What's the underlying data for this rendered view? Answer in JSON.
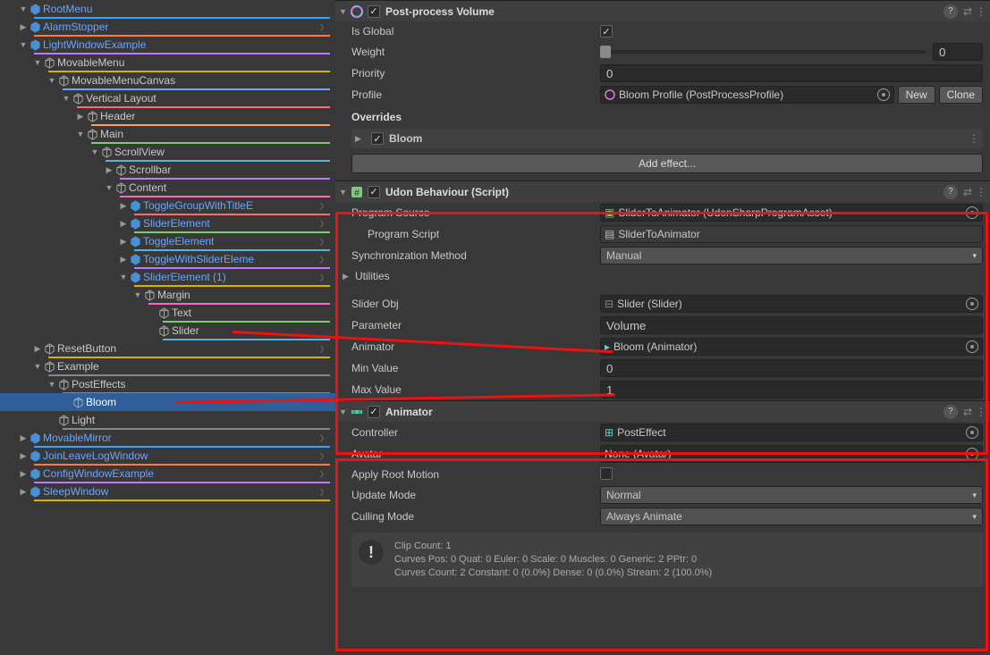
{
  "hierarchy": [
    {
      "d": 0,
      "f": "▼",
      "k": "p",
      "n": "RootMenu",
      "c": "#34a0ff",
      "ch": 0
    },
    {
      "d": 0,
      "f": "▶",
      "k": "p",
      "n": "AlarmStopper",
      "c": "#ff7a36",
      "ch": 1
    },
    {
      "d": 0,
      "f": "▼",
      "k": "p",
      "n": "LightWindowExample",
      "c": "#c178ff",
      "ch": 0
    },
    {
      "d": 1,
      "f": "▼",
      "k": "o",
      "n": "MovableMenu",
      "c": "#d6b300",
      "ch": 0
    },
    {
      "d": 2,
      "f": "▼",
      "k": "o",
      "n": "MovableMenuCanvas",
      "c": "#6aa5ff",
      "ch": 0
    },
    {
      "d": 3,
      "f": "▼",
      "k": "o",
      "n": "Vertical Layout",
      "c": "#ff6a6a",
      "ch": 0
    },
    {
      "d": 4,
      "f": "▶",
      "k": "o",
      "n": "Header",
      "c": "#ff9e5a",
      "ch": 0
    },
    {
      "d": 4,
      "f": "▼",
      "k": "o",
      "n": "Main",
      "c": "#7bcf6a",
      "ch": 0
    },
    {
      "d": 5,
      "f": "▼",
      "k": "o",
      "n": "ScrollView",
      "c": "#5ab0e0",
      "ch": 0
    },
    {
      "d": 6,
      "f": "▶",
      "k": "o",
      "n": "Scrollbar",
      "c": "#c178ff",
      "ch": 0
    },
    {
      "d": 6,
      "f": "▼",
      "k": "o",
      "n": "Content",
      "c": "#ff66c4",
      "ch": 0
    },
    {
      "d": 7,
      "f": "▶",
      "k": "p",
      "n": "ToggleGroupWithTitleE",
      "c": "#ff6a6a",
      "ch": 1
    },
    {
      "d": 7,
      "f": "▶",
      "k": "p",
      "n": "SliderElement",
      "c": "#7bcf6a",
      "ch": 1
    },
    {
      "d": 7,
      "f": "▶",
      "k": "p",
      "n": "ToggleElement",
      "c": "#5ab0e0",
      "ch": 1
    },
    {
      "d": 7,
      "f": "▶",
      "k": "p",
      "n": "ToggleWithSliderEleme",
      "c": "#c178ff",
      "ch": 1
    },
    {
      "d": 7,
      "f": "▼",
      "k": "p",
      "n": "SliderElement (1)",
      "c": "#d6b300",
      "ch": 1
    },
    {
      "d": 8,
      "f": "▼",
      "k": "o",
      "n": "Margin",
      "c": "#ff66c4",
      "ch": 0
    },
    {
      "d": 9,
      "f": "",
      "k": "o",
      "n": "Text",
      "c": "#7bcf6a",
      "ch": 0
    },
    {
      "d": 9,
      "f": "",
      "k": "o",
      "n": "Slider",
      "c": "#5ab0e0",
      "ch": 0
    },
    {
      "d": 1,
      "f": "▶",
      "k": "o",
      "n": "ResetButton",
      "c": "#d6b300",
      "ch": 1
    },
    {
      "d": 1,
      "f": "▼",
      "k": "o",
      "n": "Example",
      "c": "#888",
      "ch": 0
    },
    {
      "d": 2,
      "f": "▼",
      "k": "o",
      "n": "PostEffects",
      "c": "#888",
      "ch": 0
    },
    {
      "d": 3,
      "f": "",
      "k": "o",
      "n": "Bloom",
      "c": "#888",
      "ch": 0,
      "sel": true
    },
    {
      "d": 2,
      "f": "",
      "k": "o",
      "n": "Light",
      "c": "#888",
      "ch": 0
    },
    {
      "d": 0,
      "f": "▶",
      "k": "p",
      "n": "MovableMirror",
      "c": "#34a0ff",
      "ch": 1
    },
    {
      "d": 0,
      "f": "▶",
      "k": "p",
      "n": "JoinLeaveLogWindow",
      "c": "#ff7a36",
      "ch": 1
    },
    {
      "d": 0,
      "f": "▶",
      "k": "p",
      "n": "ConfigWindowExample",
      "c": "#c178ff",
      "ch": 1
    },
    {
      "d": 0,
      "f": "▶",
      "k": "p",
      "n": "SleepWindow",
      "c": "#d6b300",
      "ch": 1
    }
  ],
  "ppv": {
    "title": "Post-process Volume",
    "isGlobal": true,
    "weight": 0,
    "priority": "0",
    "profile": "Bloom Profile (PostProcessProfile)",
    "new": "New",
    "clone": "Clone",
    "overrides": "Overrides",
    "bloom": "Bloom",
    "addEffect": "Add effect..."
  },
  "udon": {
    "title": "Udon Behaviour (Script)",
    "programSourceLabel": "Program Source",
    "programSource": "SliderToAnimator (UdonSharpProgramAsset)",
    "programScriptLabel": "Program Script",
    "programScript": "SliderToAnimator",
    "syncLabel": "Synchronization Method",
    "sync": "Manual",
    "utilities": "Utilities",
    "sliderObjLabel": "Slider Obj",
    "sliderObj": "Slider (Slider)",
    "parameterLabel": "Parameter",
    "parameter": "Volume",
    "animatorLabel": "Animator",
    "animator": "Bloom (Animator)",
    "minLabel": "Min Value",
    "min": "0",
    "maxLabel": "Max Value",
    "max": "1"
  },
  "anim": {
    "title": "Animator",
    "controllerLabel": "Controller",
    "controller": "PostEffect",
    "avatarLabel": "Avatar",
    "avatar": "None (Avatar)",
    "rootLabel": "Apply Root Motion",
    "updateLabel": "Update Mode",
    "update": "Normal",
    "cullLabel": "Culling Mode",
    "cull": "Always Animate",
    "info1": "Clip Count: 1",
    "info2": "Curves Pos: 0 Quat: 0 Euler: 0 Scale: 0 Muscles: 0 Generic: 2 PPtr: 0",
    "info3": "Curves Count: 2 Constant: 0 (0.0%) Dense: 0 (0.0%) Stream: 2 (100.0%)"
  }
}
